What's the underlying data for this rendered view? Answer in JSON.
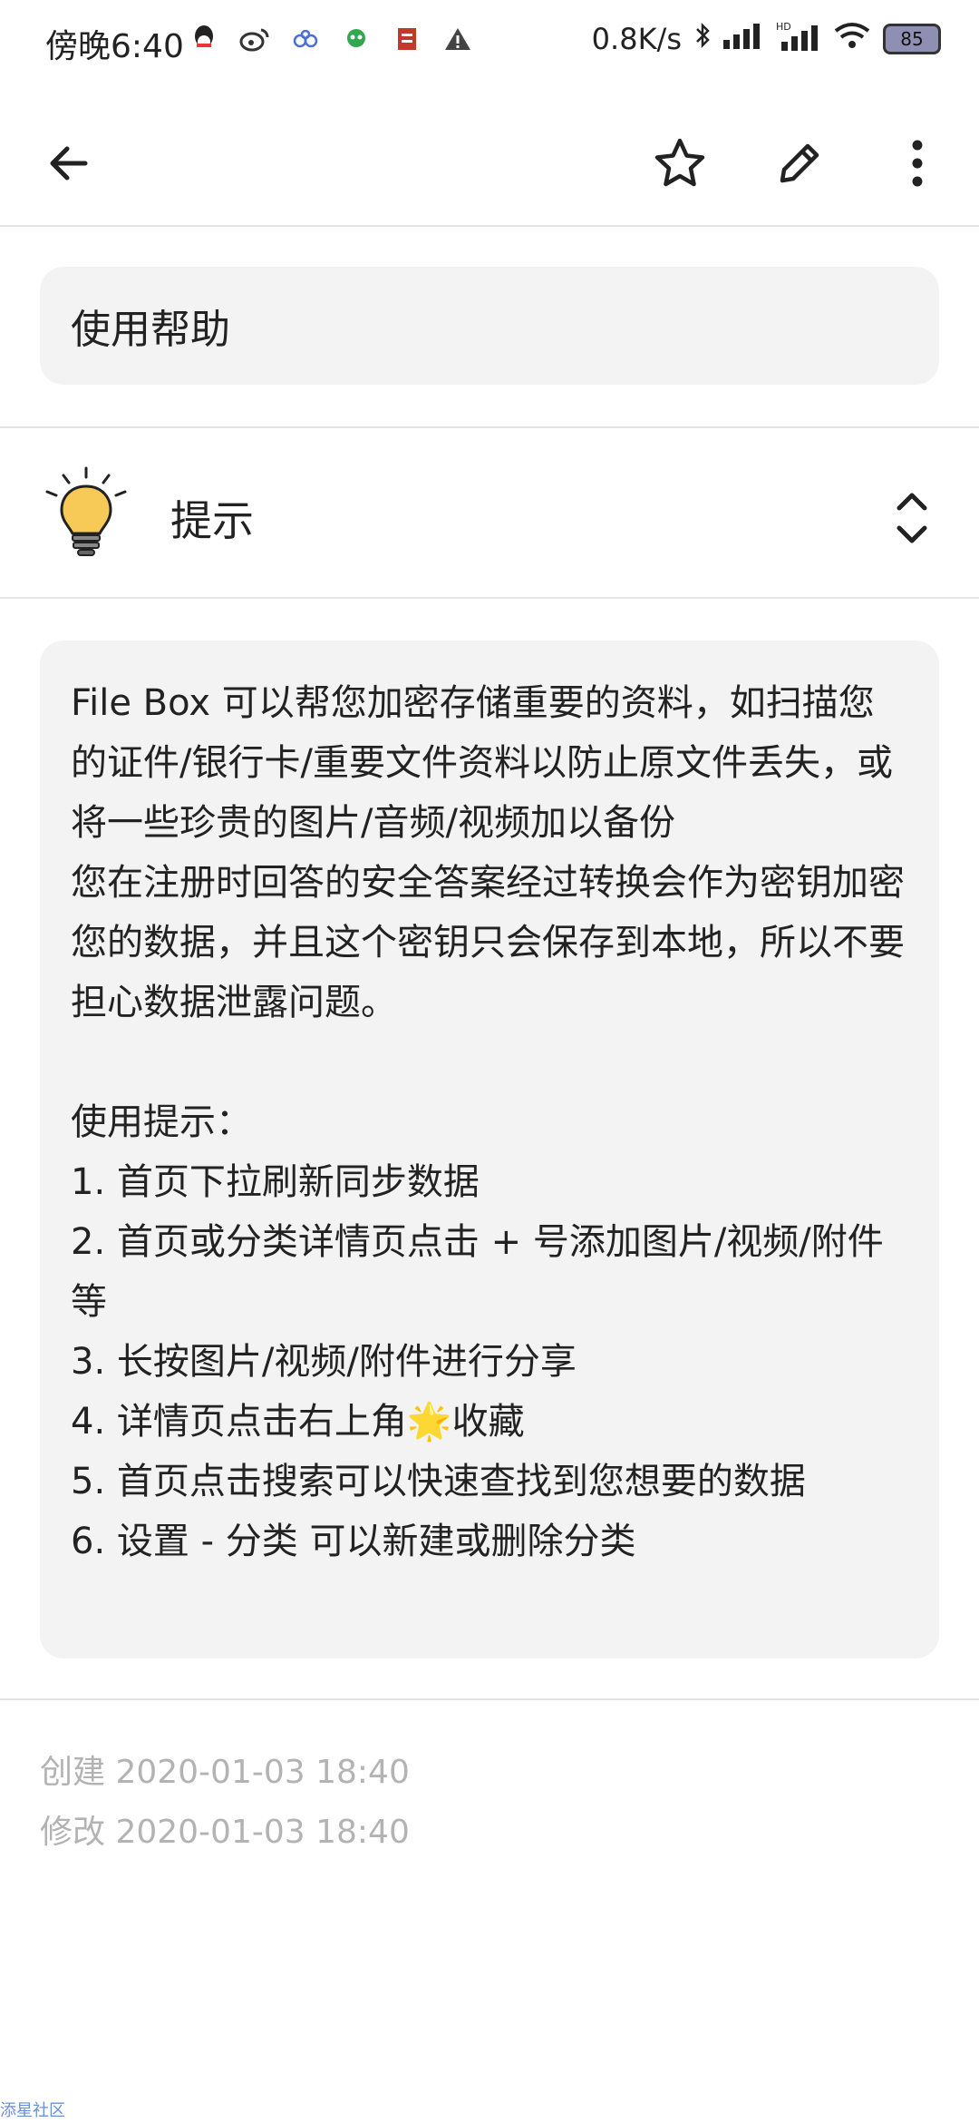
{
  "status_bar": {
    "time": "傍晚6:40",
    "net_speed": "0.8K/s",
    "battery": "85",
    "icons": [
      "qq-icon",
      "weibo-icon",
      "app-icon",
      "alien-icon",
      "calendar-icon",
      "warning-icon"
    ],
    "right_icons": [
      "bluetooth-icon",
      "signal-icon",
      "hd-signal-icon",
      "wifi-icon",
      "battery-icon"
    ]
  },
  "toolbar": {
    "back_icon": "arrow-left-icon",
    "favorite_icon": "star-outline-icon",
    "edit_icon": "pencil-icon",
    "more_icon": "more-vertical-icon"
  },
  "note": {
    "title": "使用帮助",
    "category_label": "提示",
    "category_icon": "lightbulb-icon",
    "content": "File Box 可以帮您加密存储重要的资料，如扫描您的证件/银行卡/重要文件资料以防止原文件丢失，或将一些珍贵的图片/音频/视频加以备份\n您在注册时回答的安全答案经过转换会作为密钥加密您的数据，并且这个密钥只会保存到本地，所以不要担心数据泄露问题。\n\n使用提示：\n1. 首页下拉刷新同步数据\n2. 首页或分类详情页点击 + 号添加图片/视频/附件等\n3. 长按图片/视频/附件进行分享\n4. 详情页点击右上角🌟收藏\n5. 首页点击搜索可以快速查找到您想要的数据\n6. 设置 - 分类 可以新建或删除分类",
    "created": "创建 2020-01-03 18:40",
    "modified": "修改 2020-01-03 18:40"
  },
  "watermark": "添星社区",
  "colors": {
    "box_bg": "#f3f3f3",
    "meta_text": "#b3b3b3",
    "bulb": "#f7c957"
  }
}
